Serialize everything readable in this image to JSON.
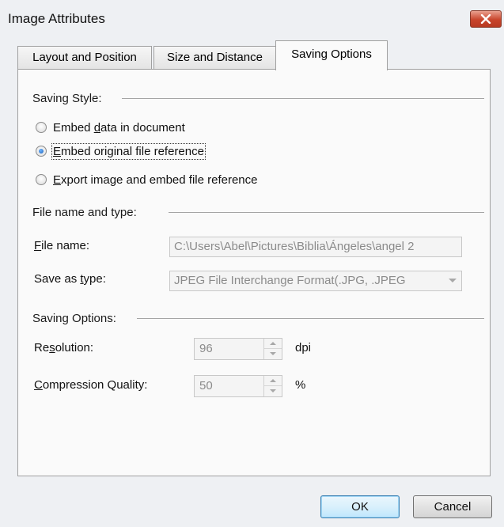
{
  "window": {
    "title": "Image Attributes"
  },
  "tabs": [
    {
      "label": "Layout and Position",
      "active": false
    },
    {
      "label": "Size and Distance",
      "active": false
    },
    {
      "label": "Saving Options",
      "active": true
    }
  ],
  "saving_style": {
    "heading": "Saving Style:",
    "options": [
      {
        "pre": "Embed ",
        "accel": "d",
        "post": "ata in document",
        "checked": false
      },
      {
        "pre": "",
        "accel": "E",
        "post": "mbed original file reference",
        "checked": true
      },
      {
        "pre": "",
        "accel": "E",
        "post": "xport image and embed file reference",
        "checked": false
      }
    ]
  },
  "file_section": {
    "heading": "File name and type:",
    "file_name_label": {
      "pre": "",
      "accel": "F",
      "post": "ile name:"
    },
    "file_name_value": "C:\\Users\\Abel\\Pictures\\Biblia\\Ángeles\\angel 2",
    "save_type_label": {
      "pre": "Save as ",
      "accel": "t",
      "post": "ype:"
    },
    "save_type_value": "JPEG File Interchange Format(.JPG, .JPEG"
  },
  "saving_options": {
    "heading": "Saving Options:",
    "resolution_label": {
      "pre": "Re",
      "accel": "s",
      "post": "olution:"
    },
    "resolution_value": "96",
    "resolution_unit": "dpi",
    "compression_label": {
      "pre": "",
      "accel": "C",
      "post": "ompression Quality:"
    },
    "compression_value": "50",
    "compression_unit": "%"
  },
  "buttons": {
    "ok": "OK",
    "cancel": "Cancel"
  },
  "colors": {
    "close_button": "#c8452c",
    "default_button_border": "#3c7fb1",
    "radio_selected": "#1d5fb8"
  },
  "icons": {
    "close": "close-icon",
    "spin_up": "spin-up-icon",
    "spin_down": "spin-down-icon",
    "dropdown": "chevron-down-icon"
  }
}
